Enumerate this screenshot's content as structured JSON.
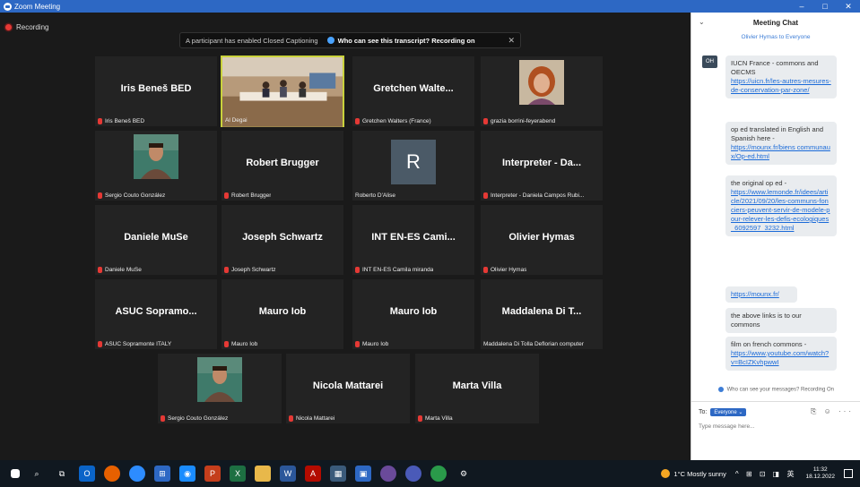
{
  "window": {
    "title": "Zoom Meeting",
    "controls": [
      "–",
      "□",
      "✕"
    ]
  },
  "recording": {
    "label": "Recording"
  },
  "cc_banner": {
    "message": "A participant has enabled Closed Captioning",
    "link": "Who can see this transcript? Recording on",
    "close": "✕"
  },
  "tiles": [
    {
      "name": "Iris Beneš BED",
      "label": "Iris Beneš BED",
      "kind": "name"
    },
    {
      "name": "",
      "label": "Al Degai",
      "kind": "room"
    },
    {
      "name": "Gretchen Walte...",
      "label": "Gretchen Walters (France)",
      "kind": "name"
    },
    {
      "name": "",
      "label": "grazia borrini-feyerabend",
      "kind": "photo-woman"
    },
    {
      "name": "",
      "label": "Sergio Couto González",
      "kind": "photo-man"
    },
    {
      "name": "Robert Brugger",
      "label": "Robert Brugger",
      "kind": "name"
    },
    {
      "name": "R",
      "label": "Roberto D'Alise",
      "kind": "avatar"
    },
    {
      "name": "Interpreter - Da...",
      "label": "Interpreter - Daniela Campos Rubi...",
      "kind": "name"
    },
    {
      "name": "Daniele MuSe",
      "label": "Daniele MuSe",
      "kind": "name"
    },
    {
      "name": "Joseph Schwartz",
      "label": "Joseph Schwartz",
      "kind": "name"
    },
    {
      "name": "INT EN-ES Cami...",
      "label": "INT EN-ES Camila miranda",
      "kind": "name"
    },
    {
      "name": "Olivier Hymas",
      "label": "Olivier Hymas",
      "kind": "name"
    },
    {
      "name": "ASUC Sopramo...",
      "label": "ASUC Sopramonte ITALY",
      "kind": "name"
    },
    {
      "name": "Mauro Iob",
      "label": "Mauro Iob",
      "kind": "name"
    },
    {
      "name": "Mauro Iob",
      "label": "Mauro Iob",
      "kind": "name"
    },
    {
      "name": "Maddalena Di T...",
      "label": "Maddalena Di Tolla Deflorian computer",
      "kind": "name"
    },
    {
      "name": "",
      "label": "Sergio Couto González",
      "kind": "photo-man"
    },
    {
      "name": "Nicola Mattarei",
      "label": "Nicola Mattarei",
      "kind": "name"
    },
    {
      "name": "Marta Villa",
      "label": "Marta Villa",
      "kind": "name"
    }
  ],
  "chat": {
    "title": "Meeting Chat",
    "to_line": "Olivier Hymas to Everyone",
    "sender_initials": "OH",
    "messages": [
      {
        "text": "IUCN France - commons and OECMS",
        "link": "https://uicn.fr/les-autres-mesures-de-conservation-par-zone/"
      },
      {
        "text": "op ed translated in English and Spanish here -",
        "link": "https://mounx.fr/biens communaux/Op-ed.html"
      },
      {
        "text": "the original op ed -",
        "link": "https://www.lemonde.fr/idees/article/2021/09/20/les-communs-fonciers-peuvent-servir-de-modele-pour-relever-les-defis-ecologiques_6092597_3232.html"
      },
      {
        "text": "",
        "link": "https://mounx.fr/"
      },
      {
        "text": "the above links is to our commons",
        "link": ""
      },
      {
        "text": "film on french commons -",
        "link": "https://www.youtube.com/watch?v=BcIZKvhpwwI"
      }
    ],
    "notice": "Who can see your messages? Recording On",
    "to_label": "To:",
    "to_value": "Everyone ⌄",
    "tools": "⎘ ☺ ···",
    "placeholder": "Type message here..."
  },
  "taskbar": {
    "weather": "1°C Mostly sunny",
    "tray_icons": "^ ⊞ ⊡ ◨ 英",
    "time": "11:32",
    "date": "18.12.2022"
  },
  "colors": {
    "accent": "#2d68c4",
    "active_border": "#c9d23c",
    "muted": "#e53935"
  }
}
